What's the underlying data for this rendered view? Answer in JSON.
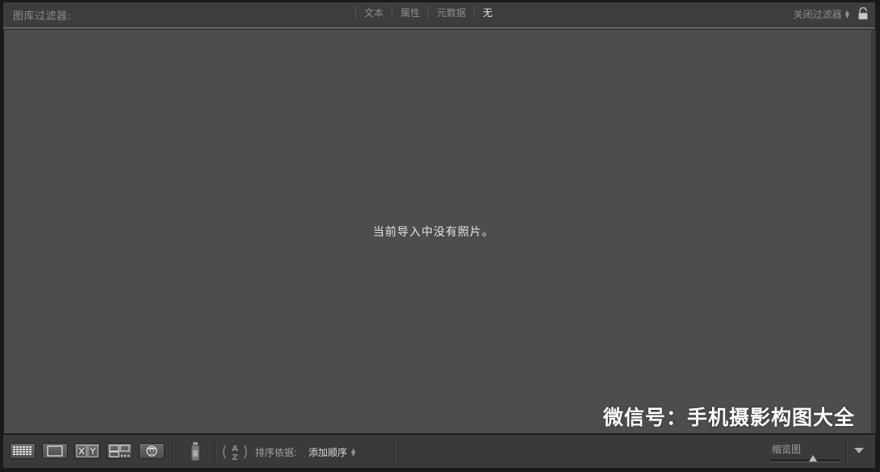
{
  "filter_bar": {
    "title": "图库过滤器:",
    "tabs": [
      {
        "label": "文本",
        "active": false
      },
      {
        "label": "属性",
        "active": false
      },
      {
        "label": "元数据",
        "active": false
      },
      {
        "label": "无",
        "active": true
      }
    ],
    "close_filter_label": "关闭过滤器",
    "lock_icon": "lock-icon"
  },
  "main": {
    "empty_message": "当前导入中没有照片。",
    "watermark": "微信号：手机摄影构图大全"
  },
  "toolbar": {
    "view_buttons": [
      {
        "icon": "grid-view-icon"
      },
      {
        "icon": "loupe-view-icon"
      },
      {
        "icon": "compare-view-icon"
      },
      {
        "icon": "survey-view-icon"
      },
      {
        "icon": "people-view-icon"
      }
    ],
    "spray_icon": "painter-spray-icon",
    "sort_icon": "sort-az-icon",
    "sort_label": "排序依据:",
    "sort_value": "添加顺序",
    "thumbnail_label": "缩览图",
    "thumbnail_size": 0.62
  },
  "colors": {
    "background": "#4d4d4d",
    "panel": "#3d3d3d",
    "text_dim": "#8c8c8c",
    "text_bright": "#e4e4e4"
  }
}
